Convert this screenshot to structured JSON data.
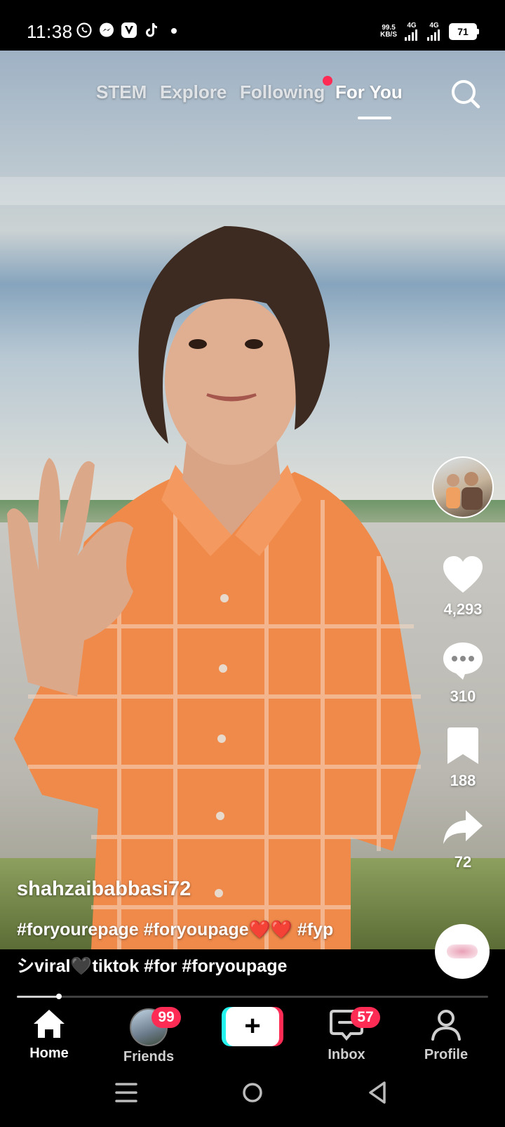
{
  "status_bar": {
    "time": "11:38",
    "app_icons": [
      "whatsapp-icon",
      "messenger-icon",
      "vmate-icon",
      "tiktok-icon"
    ],
    "net_speed_value": "99.5",
    "net_speed_unit": "KB/S",
    "signal1_label": "4G",
    "signal2_label": "4G",
    "battery": "71"
  },
  "top_tabs": {
    "items": [
      {
        "label": "STEM",
        "active": false
      },
      {
        "label": "Explore",
        "active": false
      },
      {
        "label": "Following",
        "active": false,
        "has_notification_dot": true
      },
      {
        "label": "For You",
        "active": true
      }
    ],
    "search_icon": "search-icon"
  },
  "actions": {
    "likes": "4,293",
    "comments": "310",
    "saves": "188",
    "shares": "72"
  },
  "caption": {
    "username": "shahzaibabbasi72",
    "tags_line": "#foryourepage #foryoupage❤️❤️ #fyp",
    "description_line": "シviral🖤tiktok #for #foryoupage"
  },
  "playback": {
    "progress": 0.09
  },
  "bottom_nav": {
    "items": [
      {
        "label": "Home",
        "icon": "home-icon",
        "active": true
      },
      {
        "label": "Friends",
        "icon": "friends-avatar",
        "badge": "99"
      },
      {
        "label": "",
        "icon": "plus-icon"
      },
      {
        "label": "Inbox",
        "icon": "inbox-icon",
        "badge": "57"
      },
      {
        "label": "Profile",
        "icon": "profile-icon"
      }
    ]
  },
  "colors": {
    "accent": "#fe2c55",
    "cyan": "#25f4ee",
    "background": "#000000"
  }
}
